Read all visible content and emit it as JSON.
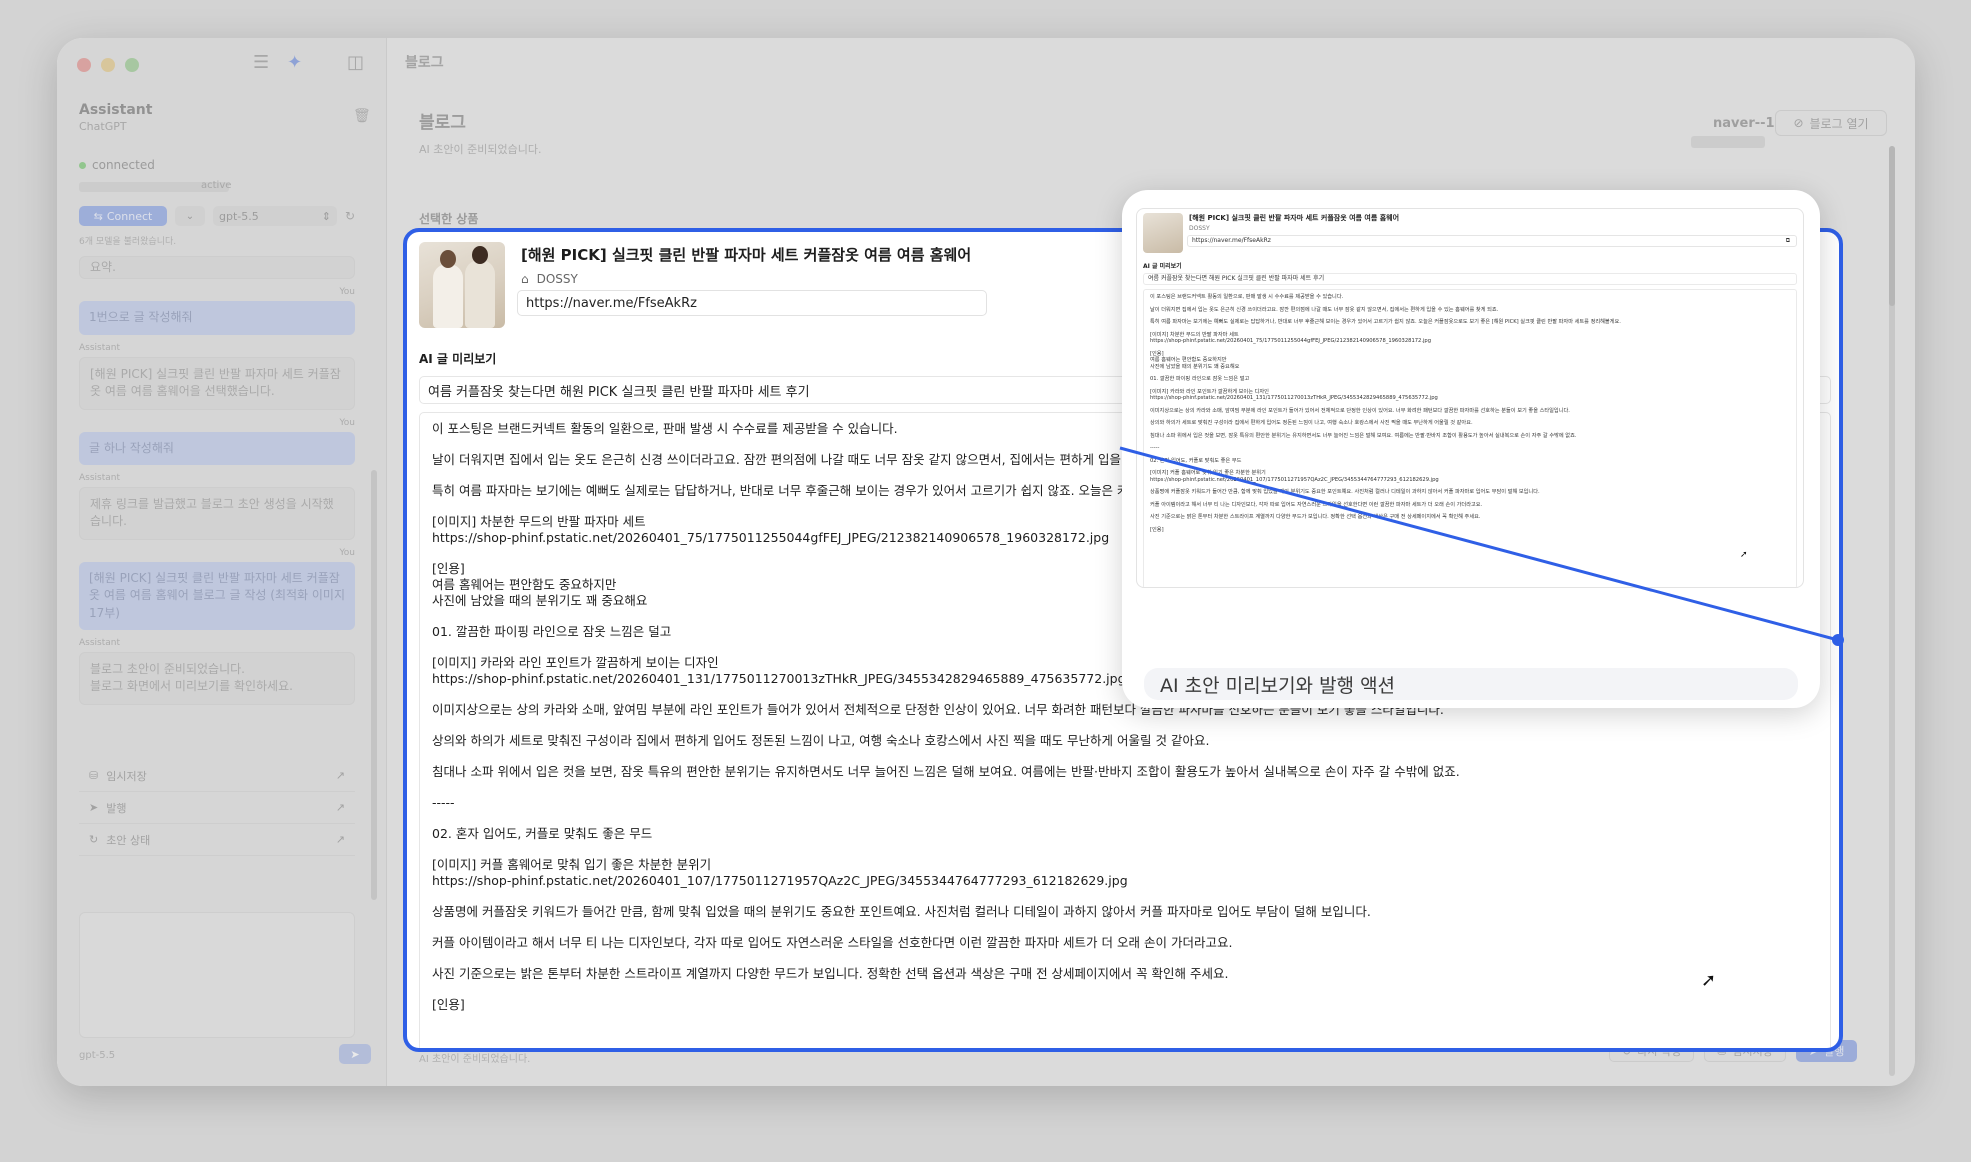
{
  "sidebar": {
    "title": "Assistant",
    "subtitle": "ChatGPT",
    "status": "connected",
    "active_label": "active",
    "connect_label": "Connect",
    "model": "gpt-5.5",
    "note": "6개 모델을 불러왔습니다.",
    "messages": [
      {
        "role": "",
        "text": "요약."
      },
      {
        "role": "You",
        "text": "1번으로 글 작성해줘"
      },
      {
        "role": "Assistant",
        "text": "[해원 PICK] 실크핏 클린 반팔 파자마 세트 커플잠옷 여름 여름 홈웨어을 선택했습니다."
      },
      {
        "role": "You",
        "text": "글 하나 작성해줘"
      },
      {
        "role": "Assistant",
        "text": "제휴 링크를 발급했고 블로그 초안 생성을 시작했습니다."
      },
      {
        "role": "You",
        "text": "[해원 PICK] 실크핏 클린 반팔 파자마 세트 커플잠옷 여름 여름 홈웨어 블로그 글 작성 (최적화 이미지 17부)"
      },
      {
        "role": "Assistant",
        "text": "블로그 초안이 준비되었습니다.\n블로그 화면에서 미리보기를 확인하세요."
      }
    ],
    "actions": [
      "임시저장",
      "발행",
      "초안 상태"
    ],
    "footer_model": "gpt-5.5"
  },
  "main": {
    "topbar": "블로그",
    "title": "블로그",
    "subtitle": "AI 초안이 준비되었습니다.",
    "account": "naver--1",
    "open_blog": "블로그 열기",
    "selected_product": "선택한 상품",
    "footer_status": "AI 초안이 준비되었습니다.",
    "btn_rewrite": "다시 작성",
    "btn_save": "임시저장",
    "btn_publish": "발행"
  },
  "product": {
    "title": "[해원 PICK] 실크핏 클린 반팔 파자마 세트 커플잠옷 여름 여름 홈웨어",
    "brand": "DOSSY",
    "url": "https://naver.me/FfseAkRz"
  },
  "preview": {
    "label": "AI 글 미리보기",
    "post_title": "여름 커플잠옷 찾는다면 해원 PICK 실크핏 클린 반팔 파자마 세트 후기",
    "paragraphs": [
      "이 포스팅은 브랜드커넥트 활동의 일환으로, 판매 발생 시 수수료를 제공받을 수 있습니다.",
      "날이 더워지면 집에서 입는 옷도 은근히 신경 쓰이더라고요. 잠깐 편의점에 나갈 때도 너무 잠옷 같지 않으면서, 집에서는 편하게 입을 수",
      "특히 여름 파자마는 보기에는 예뻐도 실제로는 답답하거나, 반대로 너무 후줄근해 보이는 경우가 있어서 고르기가 쉽지 않죠. 오늘은 커플",
      "[이미지] 차분한 무드의 반팔 파자마 세트\nhttps://shop-phinf.pstatic.net/20260401_75/1775011255044gfFEJ_JPEG/212382140906578_1960328172.jpg",
      "[인용]\n여름 홈웨어는 편안함도 중요하지만\n사진에 남았을 때의 분위기도 꽤 중요해요",
      "01. 깔끔한 파이핑 라인으로 잠옷 느낌은 덜고",
      "[이미지] 카라와 라인 포인트가 깔끔하게 보이는 디자인\nhttps://shop-phinf.pstatic.net/20260401_131/1775011270013zTHkR_JPEG/3455342829465889_475635772.jpg",
      "이미지상으로는 상의 카라와 소매, 앞여밈 부분에 라인 포인트가 들어가 있어서 전체적으로 단정한 인상이 있어요. 너무 화려한 패턴보다 깔끔한 파자마를 선호하는 분들이 보기 좋을 스타일입니다.",
      "상의와 하의가 세트로 맞춰진 구성이라 집에서 편하게 입어도 정돈된 느낌이 나고, 여행 숙소나 호캉스에서 사진 찍을 때도 무난하게 어울릴 것 같아요.",
      "침대나 소파 위에서 입은 컷을 보면, 잠옷 특유의 편안한 분위기는 유지하면서도 너무 늘어진 느낌은 덜해 보여요. 여름에는 반팔·반바지 조합이 활용도가 높아서 실내복으로 손이 자주 갈 수밖에 없죠.",
      "-----",
      "02. 혼자 입어도, 커플로 맞춰도 좋은 무드",
      "[이미지] 커플 홈웨어로 맞춰 입기 좋은 차분한 분위기\nhttps://shop-phinf.pstatic.net/20260401_107/1775011271957QAz2C_JPEG/3455344764777293_612182629.jpg",
      "상품명에 커플잠옷 키워드가 들어간 만큼, 함께 맞춰 입었을 때의 분위기도 중요한 포인트예요. 사진처럼 컬러나 디테일이 과하지 않아서 커플 파자마로 입어도 부담이 덜해 보입니다.",
      "커플 아이템이라고 해서 너무 티 나는 디자인보다, 각자 따로 입어도 자연스러운 스타일을 선호한다면 이런 깔끔한 파자마 세트가 더 오래 손이 가더라고요.",
      "사진 기준으로는 밝은 톤부터 차분한 스트라이프 계열까지 다양한 무드가 보입니다. 정확한 선택 옵션과 색상은 구매 전 상세페이지에서 꼭 확인해 주세요.",
      "[인용]"
    ]
  },
  "zoom": {
    "caption": "AI 초안 미리보기와 발행 액션",
    "paragraphs": [
      "이 포스팅은 브랜드커넥트 활동의 일환으로, 판매 발생 시 수수료를 제공받을 수 있습니다.",
      "날이 더워지면 집에서 입는 옷도 은근히 신경 쓰이더라고요. 잠깐 편의점에 나갈 때도 너무 잠옷 같지 않으면서, 집에서는 편하게 입을 수 있는 홈웨어를 찾게 되죠.",
      "특히 여름 파자마는 보기에는 예뻐도 실제로는 답답하거나, 반대로 너무 후줄근해 보이는 경우가 있어서 고르기가 쉽지 않죠. 오늘은 커플잠옷으로도 보기 좋은 [해원 PICK] 실크핏 클린 반팔 파자마 세트를 정리해볼게요.",
      "[이미지] 차분한 무드의 반팔 파자마 세트\nhttps://shop-phinf.pstatic.net/20260401_75/1775011255044gfFEJ_JPEG/212382140906578_1960328172.jpg",
      "[인용]\n여름 홈웨어는 편안함도 중요하지만\n사진에 남았을 때의 분위기도 꽤 중요해요",
      "01. 깔끔한 파이핑 라인으로 잠옷 느낌은 덜고",
      "[이미지] 카라와 라인 포인트가 깔끔하게 보이는 디자인\nhttps://shop-phinf.pstatic.net/20260401_131/1775011270013zTHkR_JPEG/3455342829465889_475635772.jpg",
      "이미지상으로는 상의 카라와 소매, 앞여밈 부분에 라인 포인트가 들어가 있어서 전체적으로 단정한 인상이 있어요. 너무 화려한 패턴보다 깔끔한 파자마를 선호하는 분들이 보기 좋을 스타일입니다.",
      "상의와 하의가 세트로 맞춰진 구성이라 집에서 편하게 입어도 정돈된 느낌이 나고, 여행 숙소나 호캉스에서 사진 찍을 때도 무난하게 어울릴 것 같아요.",
      "침대나 소파 위에서 입은 컷을 보면, 잠옷 특유의 편안한 분위기는 유지하면서도 너무 늘어진 느낌은 덜해 보여요. 여름에는 반팔·반바지 조합이 활용도가 높아서 실내복으로 손이 자주 갈 수밖에 없죠.",
      "-----",
      "02. 혼자 입어도, 커플로 맞춰도 좋은 무드",
      "[이미지] 커플 홈웨어로 맞춰 입기 좋은 차분한 분위기\nhttps://shop-phinf.pstatic.net/20260401_107/1775011271957QAz2C_JPEG/3455344764777293_612182629.jpg",
      "상품명에 커플잠옷 키워드가 들어간 만큼, 함께 맞춰 입었을 때의 분위기도 중요한 포인트예요. 사진처럼 컬러나 디테일이 과하지 않아서 커플 파자마로 입어도 부담이 덜해 보입니다.",
      "커플 아이템이라고 해서 너무 티 나는 디자인보다, 각자 따로 입어도 자연스러운 스타일을 선호한다면 이런 깔끔한 파자마 세트가 더 오래 손이 가더라고요.",
      "사진 기준으로는 밝은 톤부터 차분한 스트라이프 계열까지 다양한 무드가 보입니다. 정확한 선택 옵션과 색상은 구매 전 상세페이지에서 꼭 확인해 주세요.",
      "[인용]"
    ]
  },
  "colors": {
    "accent": "#2f5fe6",
    "window_bg": "#ececec",
    "panel_bg": "#ffffff"
  }
}
